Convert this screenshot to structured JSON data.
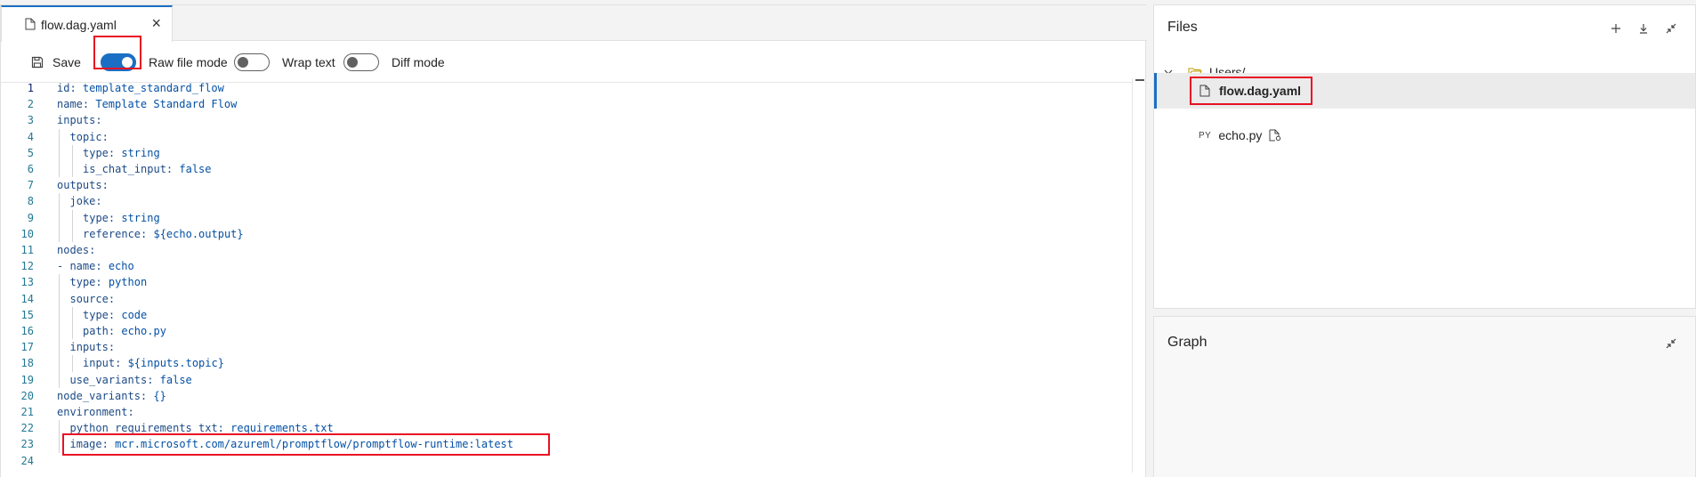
{
  "tab": {
    "label": "flow.dag.yaml",
    "close": "×"
  },
  "toolbar": {
    "save_label": "Save",
    "raw_file_mode_label": "Raw file mode",
    "raw_file_mode_on": true,
    "wrap_text_label": "Wrap text",
    "wrap_text_on": false,
    "diff_mode_label": "Diff mode",
    "diff_mode_on": false
  },
  "code_lines": [
    {
      "n": "1",
      "indent": 0,
      "key": "id",
      "sep": ": ",
      "val": "template_standard_flow"
    },
    {
      "n": "2",
      "indent": 0,
      "key": "name",
      "sep": ": ",
      "val": "Template Standard Flow"
    },
    {
      "n": "3",
      "indent": 0,
      "key": "inputs",
      "sep": ":",
      "val": ""
    },
    {
      "n": "4",
      "indent": 1,
      "key": "topic",
      "sep": ":",
      "val": ""
    },
    {
      "n": "5",
      "indent": 2,
      "key": "type",
      "sep": ": ",
      "val": "string"
    },
    {
      "n": "6",
      "indent": 2,
      "key": "is_chat_input",
      "sep": ": ",
      "val": "false"
    },
    {
      "n": "7",
      "indent": 0,
      "key": "outputs",
      "sep": ":",
      "val": ""
    },
    {
      "n": "8",
      "indent": 1,
      "key": "joke",
      "sep": ":",
      "val": ""
    },
    {
      "n": "9",
      "indent": 2,
      "key": "type",
      "sep": ": ",
      "val": "string"
    },
    {
      "n": "10",
      "indent": 2,
      "key": "reference",
      "sep": ": ",
      "val": "${echo.output}"
    },
    {
      "n": "11",
      "indent": 0,
      "key": "nodes",
      "sep": ":",
      "val": ""
    },
    {
      "n": "12",
      "indent": 0,
      "key": "- name",
      "sep": ": ",
      "val": "echo"
    },
    {
      "n": "13",
      "indent": 1,
      "key": "type",
      "sep": ": ",
      "val": "python"
    },
    {
      "n": "14",
      "indent": 1,
      "key": "source",
      "sep": ":",
      "val": ""
    },
    {
      "n": "15",
      "indent": 2,
      "key": "type",
      "sep": ": ",
      "val": "code"
    },
    {
      "n": "16",
      "indent": 2,
      "key": "path",
      "sep": ": ",
      "val": "echo.py"
    },
    {
      "n": "17",
      "indent": 1,
      "key": "inputs",
      "sep": ":",
      "val": ""
    },
    {
      "n": "18",
      "indent": 2,
      "key": "input",
      "sep": ": ",
      "val": "${inputs.topic}"
    },
    {
      "n": "19",
      "indent": 1,
      "key": "use_variants",
      "sep": ": ",
      "val": "false"
    },
    {
      "n": "20",
      "indent": 0,
      "key": "node_variants",
      "sep": ": ",
      "val": "{}"
    },
    {
      "n": "21",
      "indent": 0,
      "key": "environment",
      "sep": ":",
      "val": ""
    },
    {
      "n": "22",
      "indent": 1,
      "key": "python_requirements_txt",
      "sep": ": ",
      "val": "requirements.txt"
    },
    {
      "n": "23",
      "indent": 1,
      "key": "image",
      "sep": ": ",
      "val": "mcr.microsoft.com/azureml/promptflow/promptflow-runtime:latest"
    },
    {
      "n": "24",
      "indent": 0,
      "key": "",
      "sep": "",
      "val": ""
    }
  ],
  "files": {
    "title": "Files",
    "folder": "Users/",
    "items": [
      {
        "name": "flow.dag.yaml",
        "selected": true
      },
      {
        "name": "echo.py",
        "badge": "PY",
        "selected": false
      }
    ]
  },
  "graph": {
    "title": "Graph"
  },
  "colors": {
    "accent": "#1a6fc4",
    "highlight": "#e81123"
  }
}
